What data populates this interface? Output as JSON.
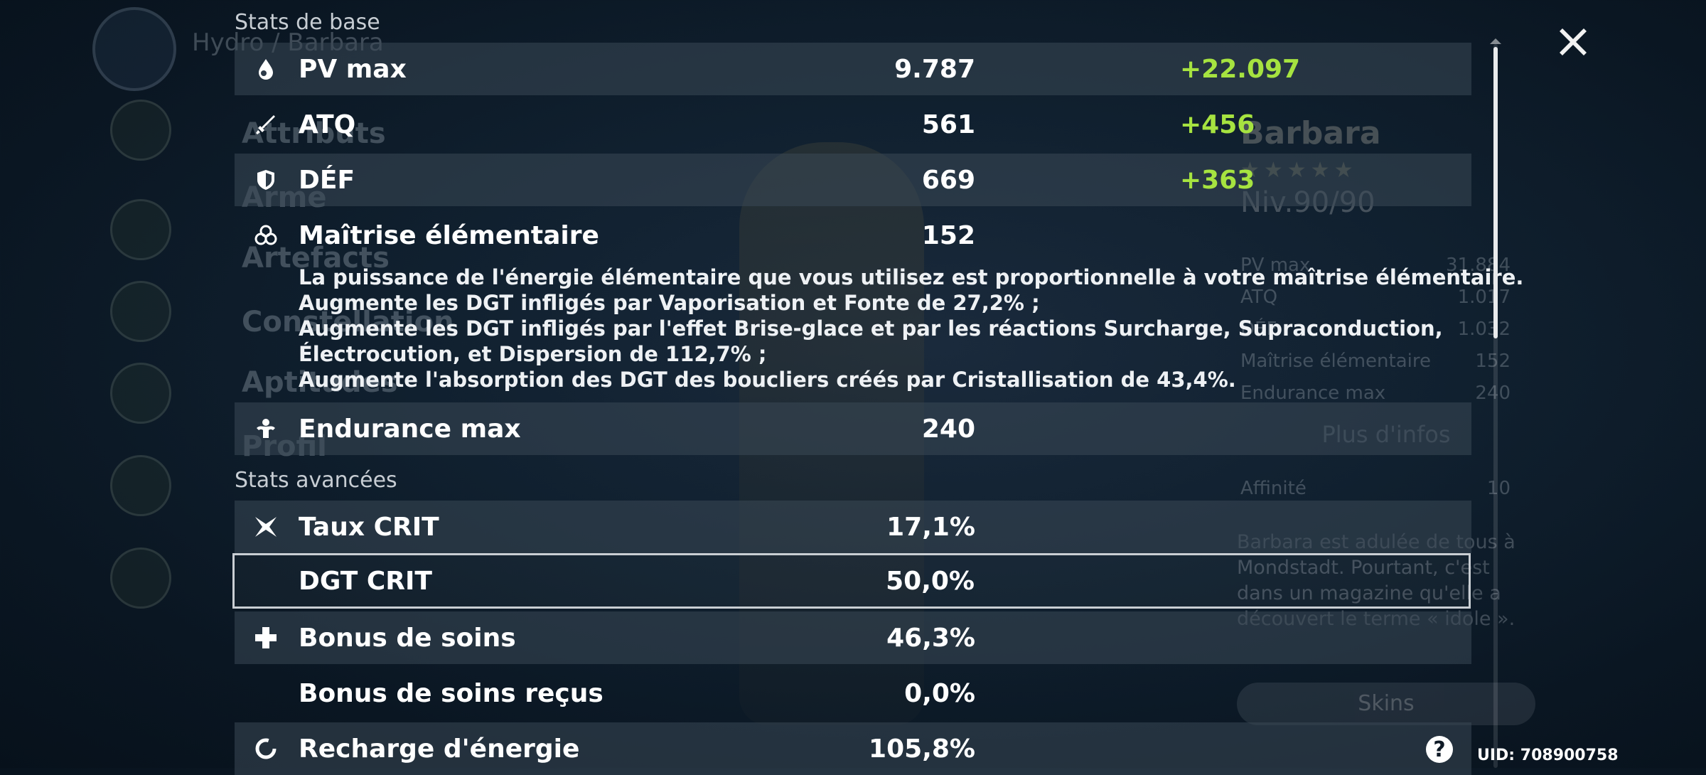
{
  "background": {
    "element_label": "Hydro / Barbara",
    "character_name": "Barbara",
    "stars": "★★★★★",
    "level": "Niv.90/90",
    "menu": [
      "Attributs",
      "Arme",
      "Artefacts",
      "Constellation",
      "Aptitudes",
      "Profil"
    ],
    "right_stats": [
      {
        "label": "PV max",
        "value": "31.884"
      },
      {
        "label": "ATQ",
        "value": "1.017"
      },
      {
        "label": "DÉF",
        "value": "1.032"
      },
      {
        "label": "Maîtrise élémentaire",
        "value": "152"
      },
      {
        "label": "Endurance max",
        "value": "240"
      }
    ],
    "more_info": "Plus d'infos",
    "affinity_label": "Affinité",
    "affinity_value": "10",
    "bio_lines": [
      "Barbara est adulée de tous à",
      "Mondstadt. Pourtant, c'est",
      "dans un magazine qu'elle a",
      "découvert le terme « idole »."
    ],
    "skins_label": "Skins"
  },
  "sections": {
    "base_title": "Stats de base",
    "advanced_title": "Stats avancées"
  },
  "base_stats": [
    {
      "icon": "hp-drop-icon",
      "label": "PV max",
      "value": "9.787",
      "bonus": "+22.097"
    },
    {
      "icon": "attack-sword-icon",
      "label": "ATQ",
      "value": "561",
      "bonus": "+456"
    },
    {
      "icon": "defense-shield-icon",
      "label": "DÉF",
      "value": "669",
      "bonus": "+363"
    },
    {
      "icon": "elemental-mastery-icon",
      "label": "Maîtrise élémentaire",
      "value": "152",
      "bonus": ""
    },
    {
      "icon": "stamina-icon",
      "label": "Endurance max",
      "value": "240",
      "bonus": ""
    }
  ],
  "mastery_description": [
    "La puissance de l'énergie élémentaire que vous utilisez est proportionnelle à votre maîtrise élémentaire.",
    "Augmente les DGT infligés par Vaporisation et Fonte de 27,2% ;",
    "Augmente les DGT infligés par l'effet Brise-glace et par les réactions Surcharge, Supraconduction,",
    "Électrocution, et Dispersion de 112,7% ;",
    "Augmente l'absorption des DGT des boucliers créés par Cristallisation de 43,4%."
  ],
  "advanced_stats": [
    {
      "icon": "crit-rate-icon",
      "label": "Taux CRIT",
      "value": "17,1%"
    },
    {
      "icon": "",
      "label": "DGT CRIT",
      "value": "50,0%"
    },
    {
      "icon": "healing-cross-icon",
      "label": "Bonus de soins",
      "value": "46,3%"
    },
    {
      "icon": "",
      "label": "Bonus de soins reçus",
      "value": "0,0%"
    },
    {
      "icon": "energy-recharge-icon",
      "label": "Recharge d'énergie",
      "value": "105,8%"
    }
  ],
  "uid": "UID: 708900758",
  "help_label": "?",
  "colors": {
    "bonus": "#a6e340",
    "row_shade": "#3a4856",
    "text": "#ffffff"
  }
}
